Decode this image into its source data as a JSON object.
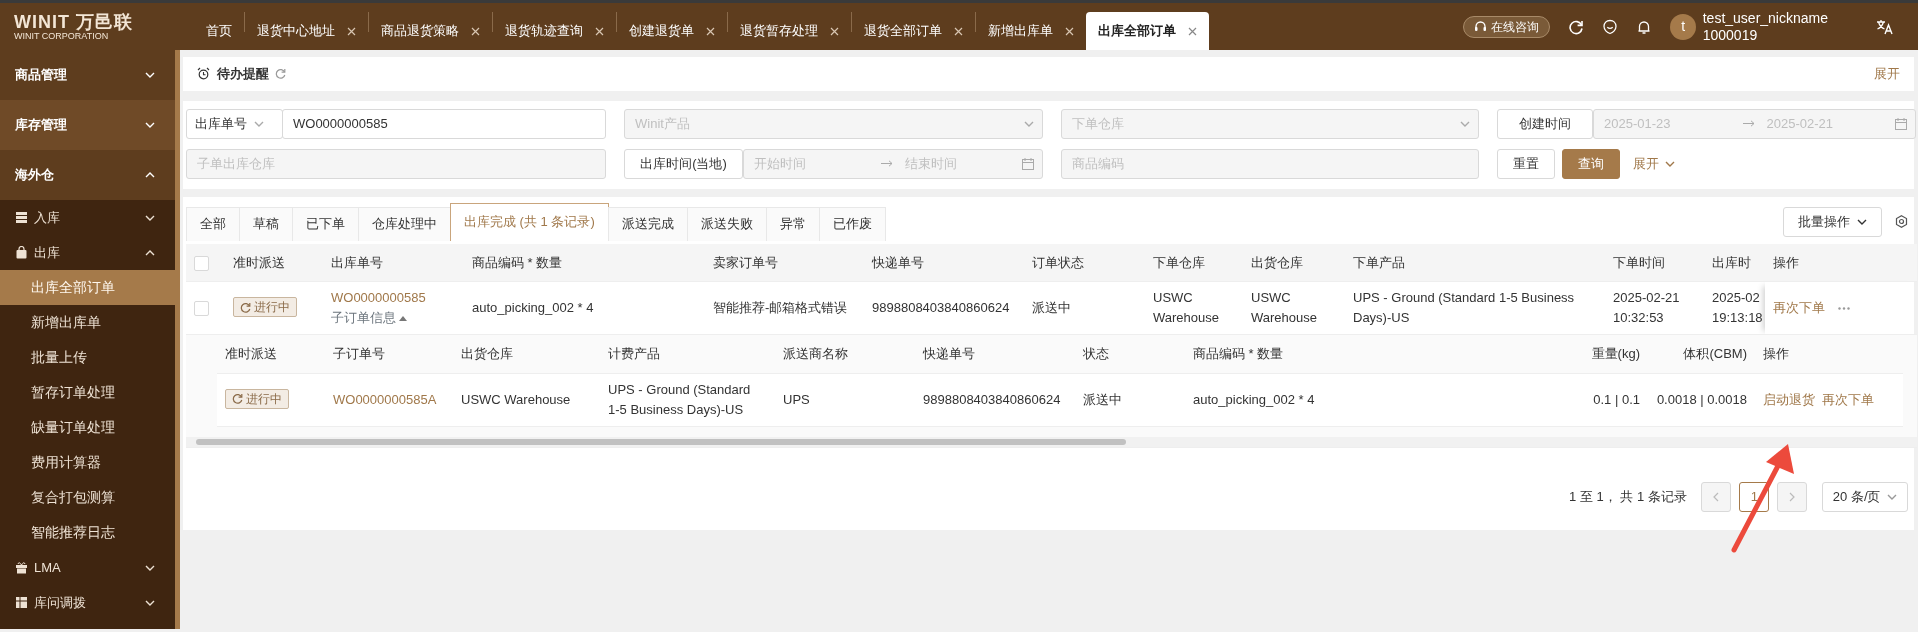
{
  "logo": {
    "mark": "WINIT",
    "cn": "万邑联",
    "sub": "WINIT CORPORATION"
  },
  "page_tabs": [
    {
      "label": "首页",
      "closable": false,
      "selected": false
    },
    {
      "label": "退货中心地址",
      "closable": true,
      "selected": false
    },
    {
      "label": "商品退货策略",
      "closable": true,
      "selected": false
    },
    {
      "label": "退货轨迹查询",
      "closable": true,
      "selected": false
    },
    {
      "label": "创建退货单",
      "closable": true,
      "selected": false
    },
    {
      "label": "退货暂存处理",
      "closable": true,
      "selected": false
    },
    {
      "label": "退货全部订单",
      "closable": true,
      "selected": false
    },
    {
      "label": "新增出库单",
      "closable": true,
      "selected": false
    },
    {
      "label": "出库全部订单",
      "closable": true,
      "selected": true
    }
  ],
  "header": {
    "consult": "在线咨询",
    "avatar": "t",
    "user_name": "test_user_nickname",
    "user_id": "1000019"
  },
  "sidebar": {
    "items": [
      {
        "label": "商品管理",
        "expanded": false,
        "hovered": false
      },
      {
        "label": "库存管理",
        "expanded": false,
        "hovered": true
      },
      {
        "label": "海外仓",
        "expanded": true,
        "hovered": false,
        "children": [
          {
            "label": "入库",
            "expanded": false
          },
          {
            "label": "出库",
            "expanded": true,
            "children": [
              {
                "label": "出库全部订单",
                "selected": true
              },
              {
                "label": "新增出库单",
                "selected": false
              },
              {
                "label": "批量上传",
                "selected": false
              },
              {
                "label": "暂存订单处理",
                "selected": false
              },
              {
                "label": "缺量订单处理",
                "selected": false
              },
              {
                "label": "费用计算器",
                "selected": false
              },
              {
                "label": "复合打包测算",
                "selected": false
              },
              {
                "label": "智能推荐日志",
                "selected": false
              }
            ]
          },
          {
            "label": "LMA",
            "expanded": false
          },
          {
            "label": "库问调拨",
            "expanded": false
          }
        ]
      }
    ]
  },
  "reminder": {
    "title": "待办提醒",
    "expand": "展开"
  },
  "filters": {
    "field_type": "出库单号",
    "order_no": {
      "value": "WO0000000585"
    },
    "product": {
      "placeholder": "Winit产品"
    },
    "warehouse": {
      "placeholder": "下单仓库"
    },
    "date_type": "创建时间",
    "created_from": {
      "placeholder": "2025-01-23"
    },
    "created_to": {
      "placeholder": "2025-02-21"
    },
    "sub_warehouse": {
      "placeholder": "子单出库仓库"
    },
    "time_type": "出库时间(当地)",
    "start": {
      "placeholder": "开始时间"
    },
    "end": {
      "placeholder": "结束时间"
    },
    "sku": {
      "placeholder": "商品编码"
    },
    "reset": "重置",
    "search": "查询",
    "expand": "展开"
  },
  "status_tabs": [
    {
      "label": "全部",
      "selected": false
    },
    {
      "label": "草稿",
      "selected": false
    },
    {
      "label": "已下单",
      "selected": false
    },
    {
      "label": "仓库处理中",
      "selected": false
    },
    {
      "label": "出库完成 (共 1 条记录)",
      "selected": true
    },
    {
      "label": "派送完成",
      "selected": false
    },
    {
      "label": "派送失败",
      "selected": false
    },
    {
      "label": "异常",
      "selected": false
    },
    {
      "label": "已作废",
      "selected": false
    }
  ],
  "batch": "批量操作",
  "table": {
    "checked": false,
    "columns": [
      "准时派送",
      "出库单号",
      "商品编码 * 数量",
      "卖家订单号",
      "快递单号",
      "订单状态",
      "下单仓库",
      "出货仓库",
      "下单产品",
      "下单时间",
      "出库时",
      "操作"
    ],
    "rows": [
      {
        "checked": false,
        "on_time": "进行中",
        "order_no": "WO0000000585",
        "sub_toggle": "子订单信息",
        "expanded": true,
        "sku_qty": "auto_picking_002 * 4",
        "seller_no": "智能推荐-邮箱格式错误",
        "tracking": "9898808403840860624",
        "status": "派送中",
        "order_wh": "USWC Warehouse",
        "ship_wh": "USWC Warehouse",
        "product": "UPS - Ground (Standard 1-5 Business Days)-US",
        "order_time": "2025-02-21 10:32:53",
        "out_time": "2025-02 19:13:18",
        "action": "再次下单",
        "sub_table": {
          "columns": [
            "准时派送",
            "子订单号",
            "出货仓库",
            "计费产品",
            "派送商名称",
            "快递单号",
            "状态",
            "商品编码 * 数量",
            "重量(kg)",
            "体积(CBM)",
            "操作"
          ],
          "rows": [
            {
              "on_time": "进行中",
              "sub_no": "WO0000000585A",
              "ship_wh": "USWC Warehouse",
              "product": "UPS - Ground (Standard 1-5 Business Days)-US",
              "carrier": "UPS",
              "tracking": "9898808403840860624",
              "status": "派送中",
              "sku_qty": "auto_picking_002 * 4",
              "weight": "0.1 | 0.1",
              "volume": "0.0018 | 0.0018",
              "actions": [
                "启动退货",
                "再次下单"
              ]
            }
          ]
        }
      }
    ]
  },
  "pagination": {
    "summary": "1 至 1， 共 1 条记录",
    "prev_disabled": true,
    "next_disabled": true,
    "pages": [
      {
        "label": "1",
        "selected": true
      }
    ],
    "page_size": "20 条/页"
  }
}
